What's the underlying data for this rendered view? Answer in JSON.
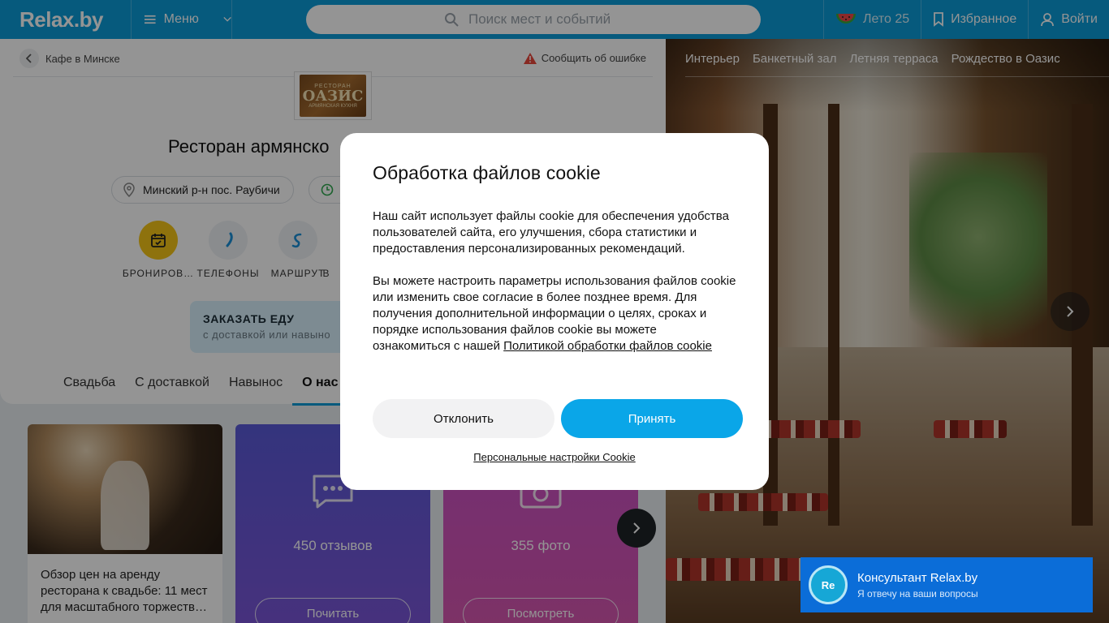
{
  "header": {
    "logo": "Relax.by",
    "menu_label": "Меню",
    "search_placeholder": "Поиск мест и событий",
    "summer_label": "Лето 25",
    "favorites_label": "Избранное",
    "login_label": "Войти"
  },
  "breadcrumb": {
    "back_label": "Кафе в Минске"
  },
  "report_label": "Сообщить об ошибке",
  "venue": {
    "logo_line1": "РЕСТОРАН",
    "logo_line2": "ОАЗИС",
    "logo_line3": "АРМЯНСКАЯ КУХНЯ",
    "title": "Ресторан армянско",
    "address": "Минский р-н пос. Раубичи"
  },
  "actions": [
    {
      "label": "БРОНИРОВ…"
    },
    {
      "label": "ТЕЛЕФОНЫ"
    },
    {
      "label": "МАРШРУТ"
    },
    {
      "label": "В"
    }
  ],
  "order": {
    "title": "ЗАКАЗАТЬ ЕДУ",
    "subtitle": "с доставкой или навыно"
  },
  "tabs": [
    {
      "label": "Свадьба"
    },
    {
      "label": "С доставкой"
    },
    {
      "label": "Навынос"
    },
    {
      "label": "О нас"
    }
  ],
  "cards": {
    "article_caption": "Обзор цен на аренду ресторана к свадьбе: 11 мест для масштабного торжеств…",
    "reviews_count": "450 отзывов",
    "reviews_button": "Почитать",
    "photos_count": "355 фото",
    "photos_button": "Посмотреть"
  },
  "gallery": {
    "tabs": [
      "Интерьер",
      "Банкетный зал",
      "Летняя терраса",
      "Рождество в Оазис"
    ]
  },
  "consultant": {
    "avatar": "Re",
    "name": "Консультант Relax.by",
    "subtitle": "Я отвечу на ваши вопросы"
  },
  "cookie_modal": {
    "title": "Обработка файлов cookie",
    "paragraph1": "Наш сайт использует файлы cookie для обеспечения удобства пользователей сайта, его улучшения, сбора статистики и предоставления персонализированных рекомендаций.",
    "paragraph2_text": "Вы можете настроить параметры использования файлов cookie или изменить свое согласие в более позднее время. Для получения дополнительной информации о целях, сроках и порядке использования файлов cookie вы можете ознакомиться с нашей ",
    "policy_link": "Политикой обработки файлов cookie",
    "decline_label": "Отклонить",
    "accept_label": "Принять",
    "settings_link": "Персональные настройки Cookie"
  },
  "colors": {
    "header_blue": "#0b9bd8",
    "accept_blue": "#0aa6e8",
    "booking_yellow": "#f5c518",
    "consultant_blue": "#0b6dd8"
  }
}
